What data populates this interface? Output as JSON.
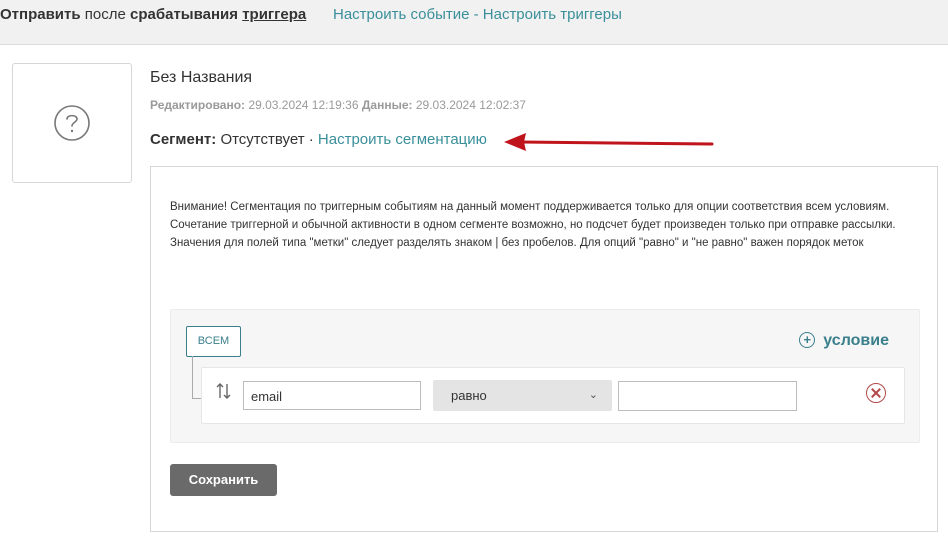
{
  "topbar": {
    "send_prefix": "Отправить",
    "send_middle": " после ",
    "send_bold": "срабатывания",
    "trigger_word": "триггера",
    "link_event_text": "Настроить событие - Настроить триггеры"
  },
  "item": {
    "title": "Без Названия",
    "edited_label": "Редактировано:",
    "edited_value": "29.03.2024 12:19:36",
    "data_label": "Данные:",
    "data_value": "29.03.2024 12:02:37",
    "thumbnail_icon": "question-circle-icon"
  },
  "segment": {
    "label": "Сегмент:",
    "value": "Отсутствует",
    "separator": "·",
    "link": "Настроить сегментацию",
    "arrow_color": "#c0141c"
  },
  "notice": {
    "line1": "Внимание! Сегментация по триггерным событиям на данный момент поддерживается только для опции соответствия всем условиям. Сочетание триггерной и обычной активности в одном сегменте возможно, но подсчет будет произведен только при отправке рассылки.",
    "line2": "Значения для полей типа \"метки\" следует разделять знаком | без пробелов. Для опций \"равно\" и \"не равно\" важен порядок меток"
  },
  "conditions": {
    "match_button": "ВСЕМ",
    "add_condition": "условие",
    "rows": [
      {
        "field": "email",
        "operator": "равно",
        "value": ""
      }
    ]
  },
  "actions": {
    "save": "Сохранить"
  },
  "colors": {
    "accent": "#3a8f9a",
    "remove": "#b24a4a",
    "save_bg": "#6a6a6a"
  }
}
